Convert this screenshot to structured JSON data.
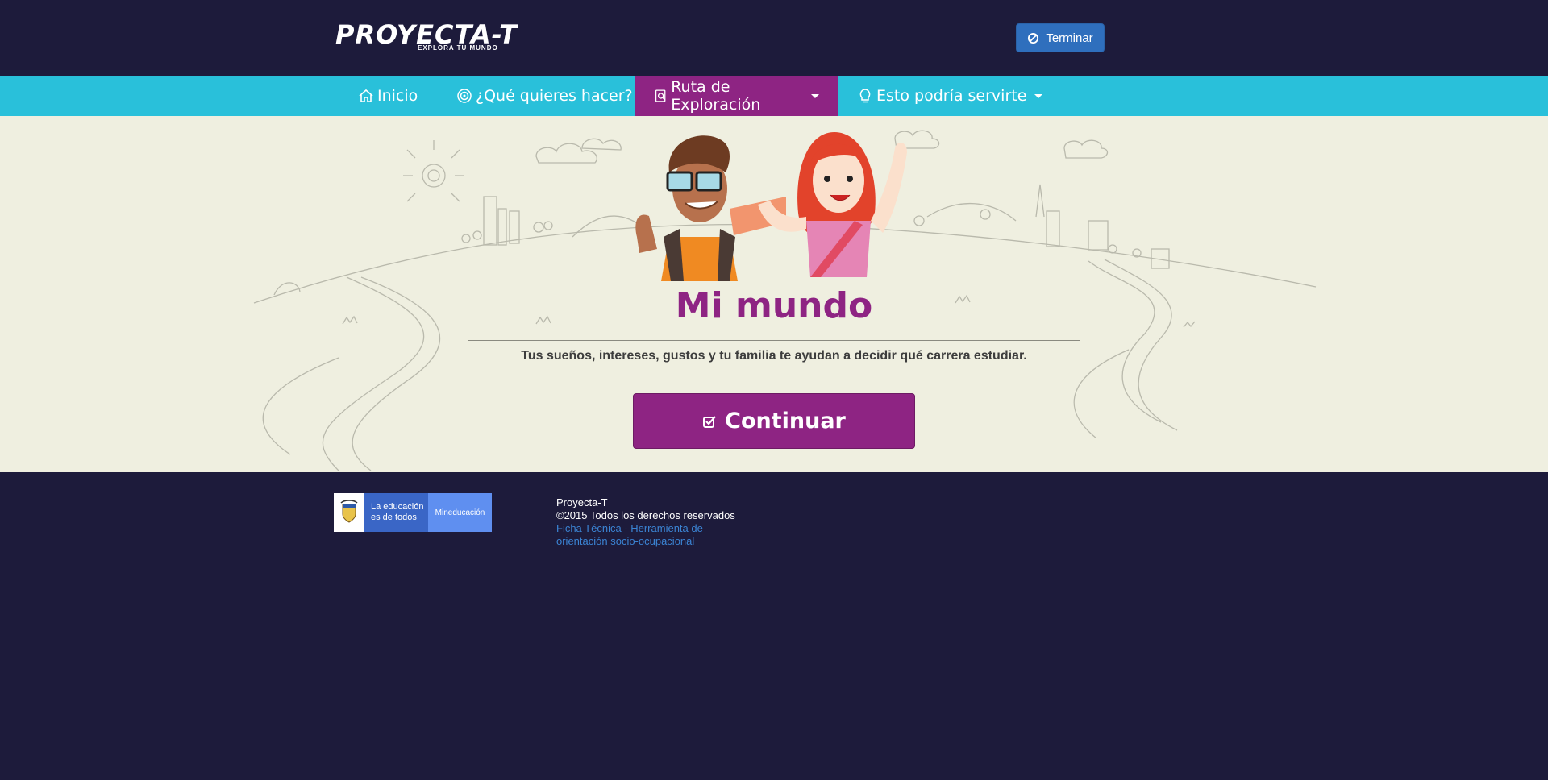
{
  "header": {
    "logo_text": "PROYECTA-T",
    "logo_tagline": "EXPLORA TU MUNDO",
    "terminar_label": "Terminar"
  },
  "nav": {
    "items": [
      {
        "label": "Inicio",
        "icon": "home-icon"
      },
      {
        "label": "¿Qué quieres hacer?",
        "icon": "target-icon"
      },
      {
        "label": "Ruta de Exploración",
        "icon": "search-doc-icon",
        "active": true,
        "dropdown": true
      },
      {
        "label": "Esto podría servirte",
        "icon": "lightbulb-icon",
        "dropdown": true
      }
    ]
  },
  "main": {
    "title": "Mi mundo",
    "subtitle": "Tus sueños, intereses, gustos y tu familia te ayudan a decidir qué carrera estudiar.",
    "continue_label": "Continuar"
  },
  "footer": {
    "logo_edu": "La educación es de todos",
    "logo_min": "Mineducación",
    "site_name": "Proyecta-T",
    "copyright": "©2015 Todos los derechos reservados",
    "ficha_link": "Ficha Técnica - Herramienta de orientación socio-ocupacional"
  },
  "colors": {
    "navy": "#1d1b3b",
    "cyan": "#29c0da",
    "purple": "#8e2483",
    "cream": "#efefe0",
    "blue_button": "#2f6fbd"
  }
}
